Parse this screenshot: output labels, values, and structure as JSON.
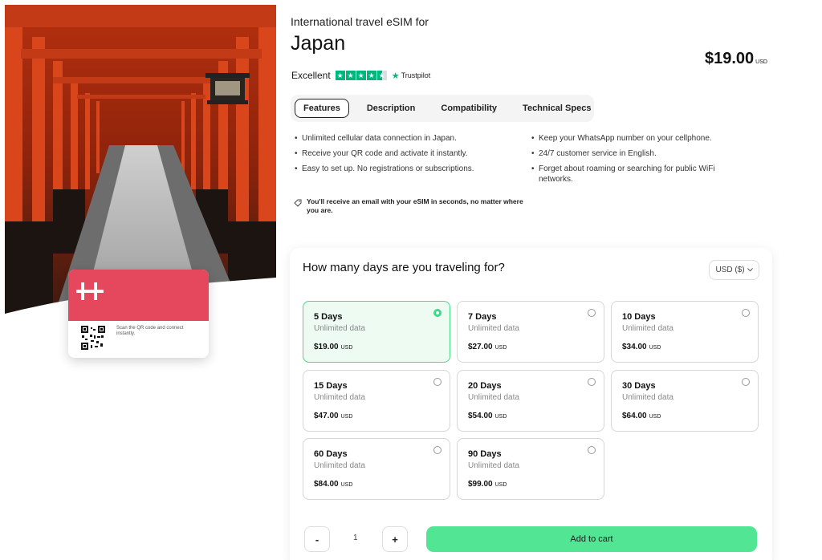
{
  "product": {
    "subtitle": "International travel eSIM for",
    "title": "Japan",
    "price": "$19.00",
    "price_currency": "USD"
  },
  "rating": {
    "label": "Excellent",
    "stars": 4.5,
    "provider": "Trustpilot"
  },
  "tabs": [
    {
      "label": "Features",
      "active": true
    },
    {
      "label": "Description",
      "active": false
    },
    {
      "label": "Compatibility",
      "active": false
    },
    {
      "label": "Technical Specs",
      "active": false
    }
  ],
  "features_left": [
    "Unlimited cellular data connection in Japan.",
    "Receive your QR code and activate it instantly.",
    "Easy to set up. No registrations or subscriptions."
  ],
  "features_right": [
    "Keep your WhatsApp number on your cellphone.",
    "24/7 customer service in English.",
    "Forget about roaming or searching for public WiFi networks."
  ],
  "email_note": "You'll receive an email with your eSIM in seconds, no matter where you are.",
  "card": {
    "qr_caption": "Scan the QR code and connect instantly."
  },
  "plans_section": {
    "question": "How many days are you traveling for?",
    "currency": "USD ($)",
    "plans": [
      {
        "name": "5 Days",
        "data": "Unlimited data",
        "price": "$19.00",
        "currency": "USD",
        "selected": true
      },
      {
        "name": "7 Days",
        "data": "Unlimited data",
        "price": "$27.00",
        "currency": "USD",
        "selected": false
      },
      {
        "name": "10 Days",
        "data": "Unlimited data",
        "price": "$34.00",
        "currency": "USD",
        "selected": false
      },
      {
        "name": "15 Days",
        "data": "Unlimited data",
        "price": "$47.00",
        "currency": "USD",
        "selected": false
      },
      {
        "name": "20 Days",
        "data": "Unlimited data",
        "price": "$54.00",
        "currency": "USD",
        "selected": false
      },
      {
        "name": "30 Days",
        "data": "Unlimited data",
        "price": "$64.00",
        "currency": "USD",
        "selected": false
      },
      {
        "name": "60 Days",
        "data": "Unlimited data",
        "price": "$84.00",
        "currency": "USD",
        "selected": false
      },
      {
        "name": "90 Days",
        "data": "Unlimited data",
        "price": "$99.00",
        "currency": "USD",
        "selected": false
      }
    ]
  },
  "cart": {
    "minus": "-",
    "quantity": "1",
    "plus": "+",
    "add_label": "Add to cart"
  },
  "colors": {
    "accent_green": "#52e694",
    "brand_red": "#e5475c",
    "trustpilot_green": "#00b67a"
  }
}
